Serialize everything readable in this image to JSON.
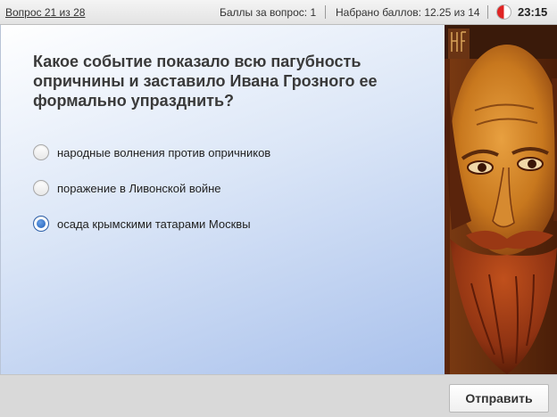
{
  "header": {
    "question_counter": "Вопрос 21 из 28",
    "points_per_question": "Баллы за вопрос: 1",
    "total_points": "Набрано баллов: 12.25 из 14",
    "timer": "23:15"
  },
  "question": {
    "text": "Какое событие показало всю пагубность опричнины и заставило Ивана Грозного ее формально упразднить?",
    "options": [
      {
        "label": "народные волнения против опричников",
        "selected": false
      },
      {
        "label": "поражение в Ливонской войне",
        "selected": false
      },
      {
        "label": "осада крымскими татарами Москвы",
        "selected": true
      }
    ]
  },
  "illustration": {
    "subject": "icon-portrait-ivan-the-terrible"
  },
  "footer": {
    "submit_label": "Отправить"
  },
  "colors": {
    "accent": "#1f5fb8",
    "timer_red": "#e02424",
    "panel_gradient_end": "#a9c1ec"
  }
}
